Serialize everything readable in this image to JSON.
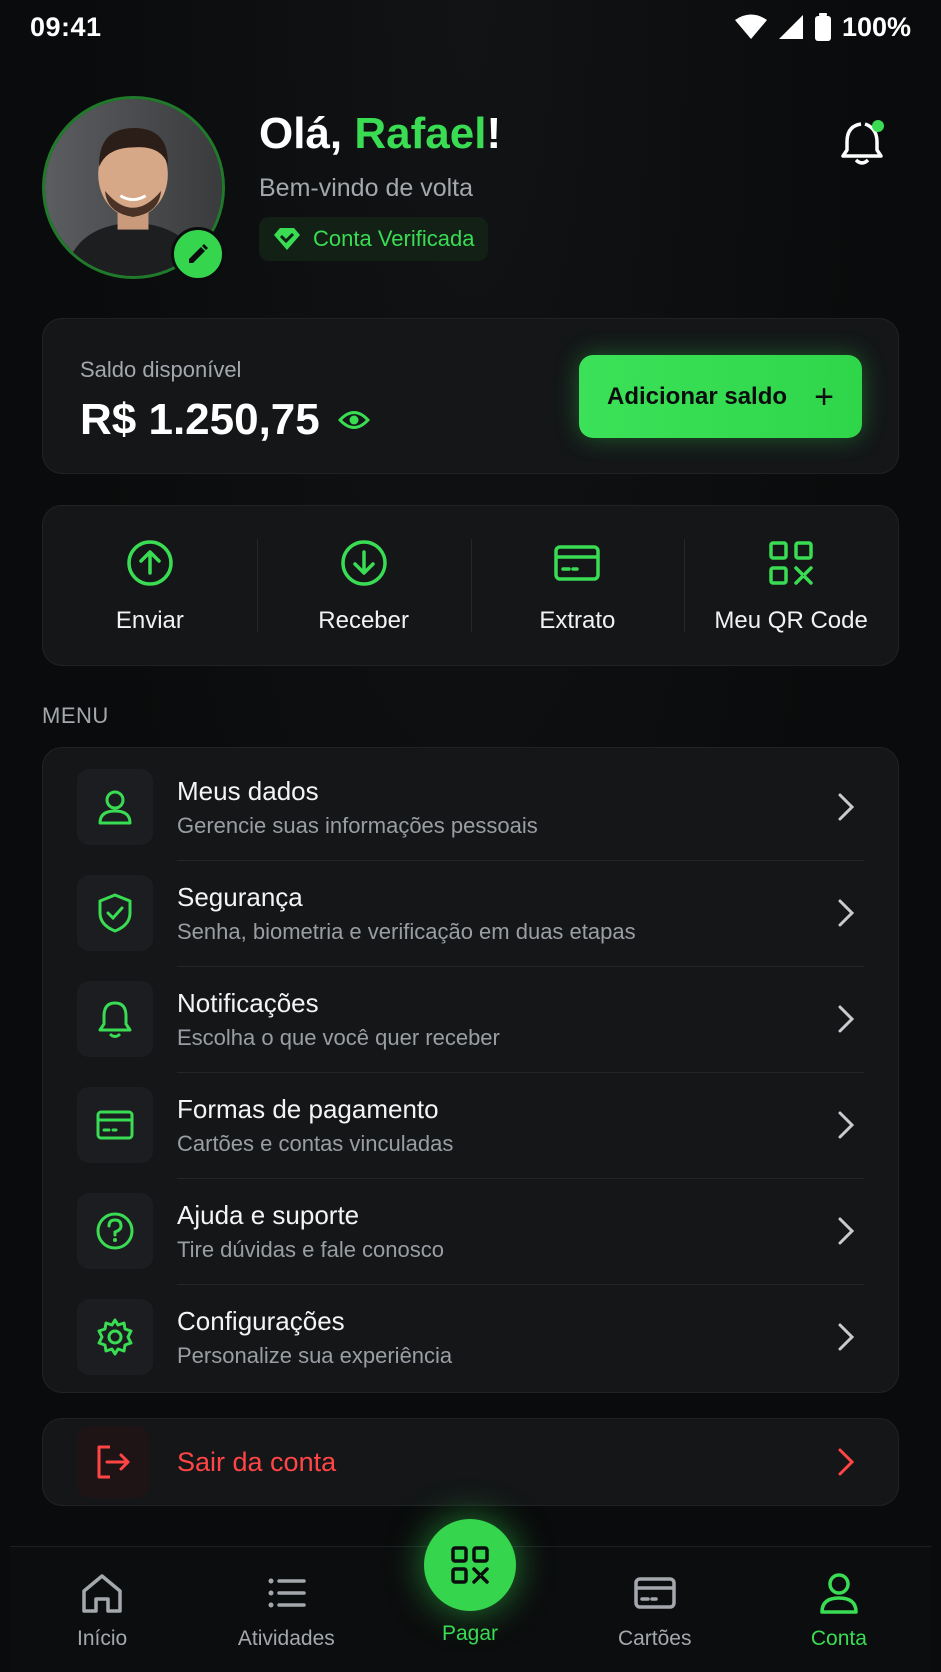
{
  "status_bar": {
    "time": "09:41",
    "battery": "100%"
  },
  "profile": {
    "greeting_prefix": "Olá, ",
    "name": "Rafael",
    "greeting_suffix": "!",
    "subtitle": "Bem-vindo de volta",
    "verified_label": "Conta Verificada",
    "has_notification": true
  },
  "balance": {
    "label": "Saldo disponível",
    "amount": "R$ 1.250,75",
    "add_button": "Adicionar saldo"
  },
  "quick_actions": [
    {
      "label": "Enviar",
      "icon": "arrow-up-circle-icon"
    },
    {
      "label": "Receber",
      "icon": "arrow-down-circle-icon"
    },
    {
      "label": "Extrato",
      "icon": "card-icon"
    },
    {
      "label": "Meu QR Code",
      "icon": "qr-code-icon"
    }
  ],
  "menu": {
    "title": "MENU",
    "items": [
      {
        "title": "Meus dados",
        "subtitle": "Gerencie suas informações pessoais",
        "icon": "user-icon"
      },
      {
        "title": "Segurança",
        "subtitle": "Senha, biometria e verificação em duas etapas",
        "icon": "shield-icon"
      },
      {
        "title": "Notificações",
        "subtitle": "Escolha o que você quer receber",
        "icon": "bell-icon"
      },
      {
        "title": "Formas de pagamento",
        "subtitle": "Cartões e contas vinculadas",
        "icon": "card-icon"
      },
      {
        "title": "Ajuda e suporte",
        "subtitle": "Tire dúvidas e fale conosco",
        "icon": "help-icon"
      },
      {
        "title": "Configurações",
        "subtitle": "Personalize sua experiência",
        "icon": "gear-icon"
      }
    ]
  },
  "logout": {
    "label": "Sair da conta"
  },
  "bottom_nav": {
    "items": [
      {
        "label": "Início",
        "icon": "home-icon"
      },
      {
        "label": "Atividades",
        "icon": "list-icon"
      },
      {
        "label": "Pagar",
        "icon": "qr-code-icon"
      },
      {
        "label": "Cartões",
        "icon": "card-icon"
      },
      {
        "label": "Conta",
        "icon": "user-icon"
      }
    ],
    "active": "Conta"
  },
  "colors": {
    "accent": "#39dc52",
    "danger": "#ff4545",
    "background": "#0b0c0d",
    "card": "#141618"
  }
}
